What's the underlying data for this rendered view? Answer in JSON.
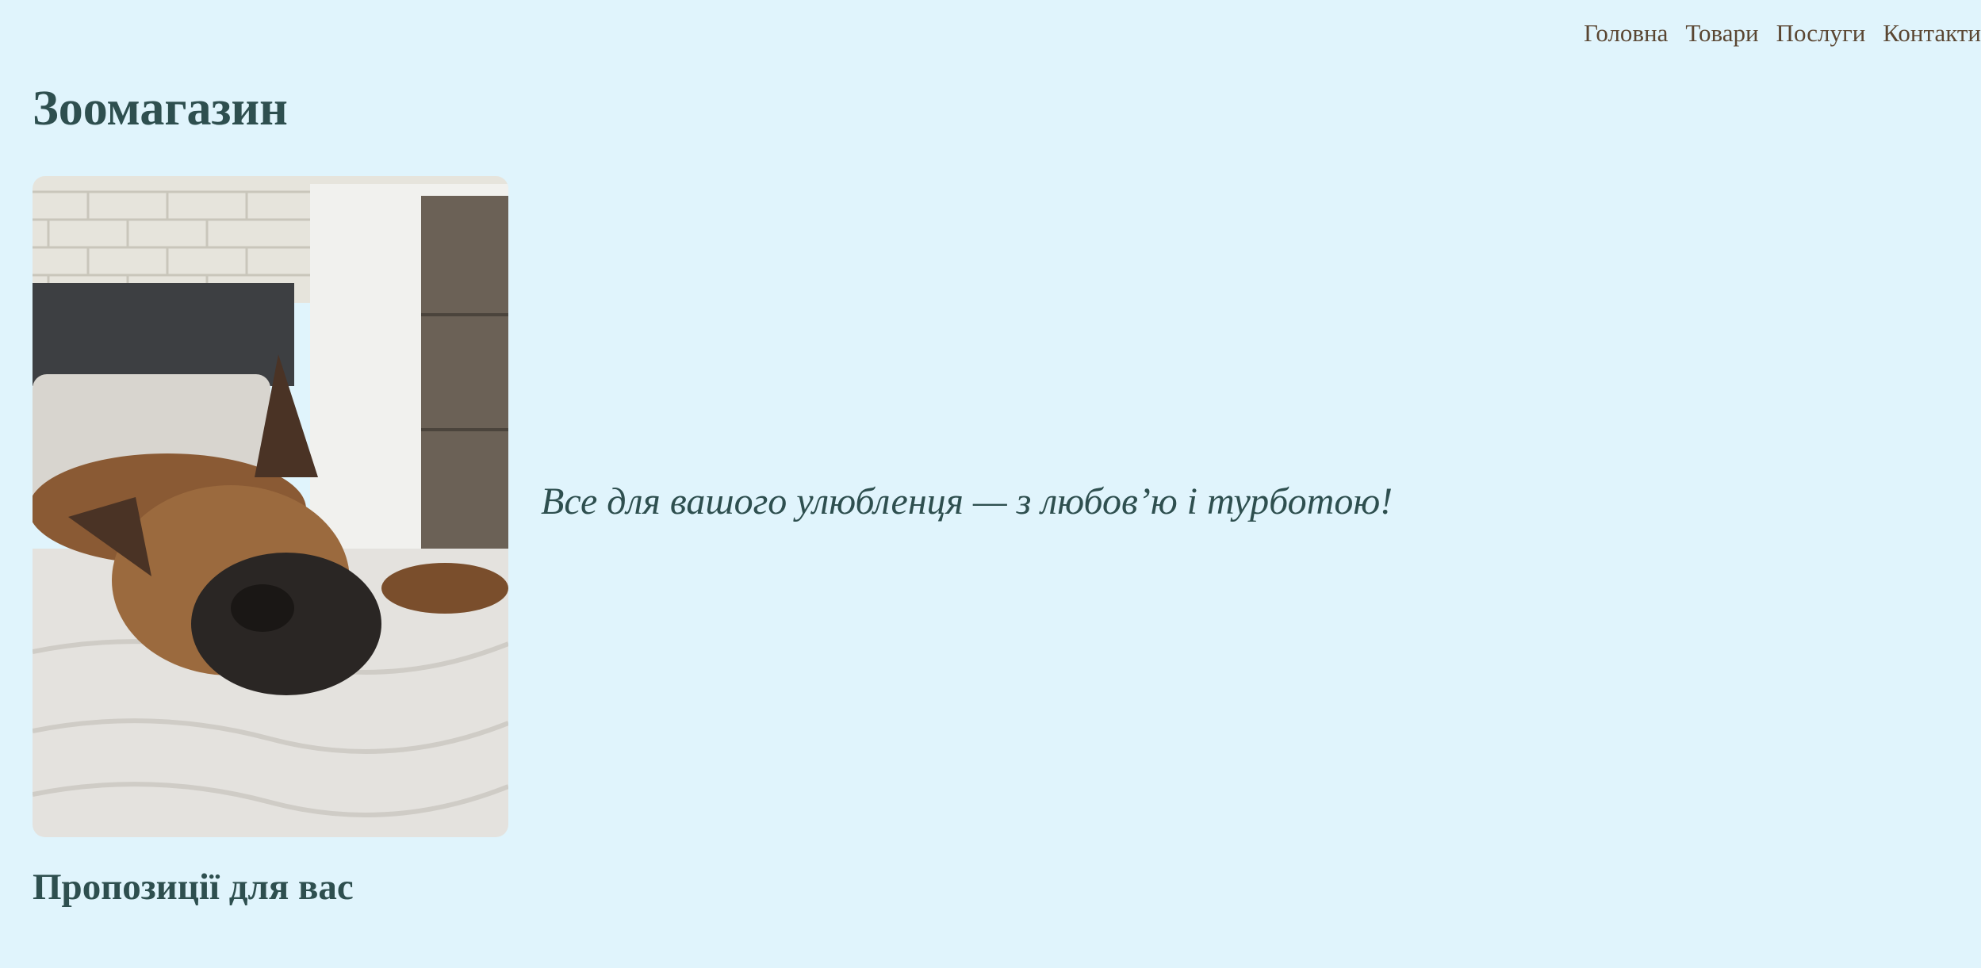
{
  "nav": {
    "items": [
      {
        "label": "Головна"
      },
      {
        "label": "Товари"
      },
      {
        "label": "Послуги"
      },
      {
        "label": "Контакти"
      }
    ]
  },
  "header": {
    "title": "Зоомагазин"
  },
  "hero": {
    "tagline": "Все для вашого улюбленця — з любов’ю і турботою!"
  },
  "offers": {
    "title": "Пропозиції для вас"
  },
  "colors": {
    "background": "#e0f4fc",
    "heading": "#2e4f4f",
    "nav_link": "#5a4632"
  }
}
